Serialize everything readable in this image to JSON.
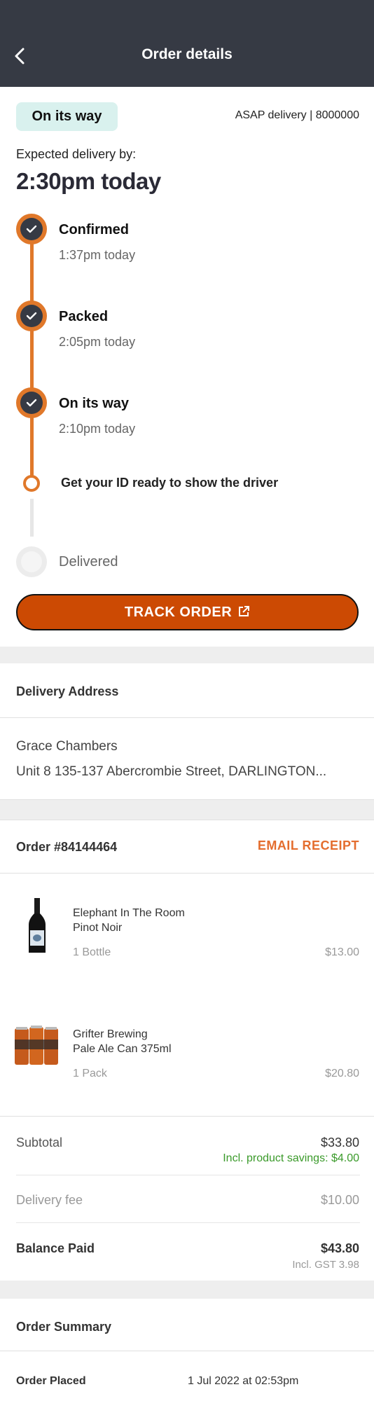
{
  "header": {
    "title": "Order details",
    "back_icon": "chevron-left-icon"
  },
  "status": {
    "badge": "On its way",
    "delivery_meta": "ASAP delivery  | 8000000",
    "expected_label": "Expected delivery by:",
    "expected_time": "2:30pm today"
  },
  "timeline": {
    "steps": [
      {
        "title": "Confirmed",
        "time": "1:37pm today"
      },
      {
        "title": "Packed",
        "time": "2:05pm today"
      },
      {
        "title": "On its way",
        "time": "2:10pm today"
      }
    ],
    "id_note": "Get your ID ready to show the driver",
    "delivered": "Delivered"
  },
  "track_button": "TRACK ORDER",
  "address": {
    "title": "Delivery Address",
    "name": "Grace Chambers",
    "line": "Unit 8  135-137 Abercrombie Street, DARLINGTON..."
  },
  "order": {
    "title": "Order #84144464",
    "email_receipt": "EMAIL RECEIPT",
    "items": [
      {
        "name_line1": "Elephant In The Room",
        "name_line2": "Pinot Noir",
        "qty": "1 Bottle",
        "price": "$13.00"
      },
      {
        "name_line1": "Grifter Brewing",
        "name_line2": "Pale Ale Can 375ml",
        "qty": "1 Pack",
        "price": "$20.80"
      }
    ]
  },
  "totals": {
    "subtotal_label": "Subtotal",
    "subtotal_value": "$33.80",
    "savings": "Incl. product savings: $4.00",
    "delivery_label": "Delivery fee",
    "delivery_value": "$10.00",
    "balance_label": "Balance Paid",
    "balance_value": "$43.80",
    "gst": "Incl. GST 3.98"
  },
  "summary": {
    "title": "Order Summary",
    "placed_label": "Order Placed",
    "placed_value": "1 Jul 2022 at 02:53pm"
  },
  "colors": {
    "header_bg": "#363a44",
    "accent_orange": "#e0782a",
    "button_bg": "#cc4a03",
    "badge_bg": "#d9f1ee",
    "savings_green": "#3a9a2a"
  }
}
